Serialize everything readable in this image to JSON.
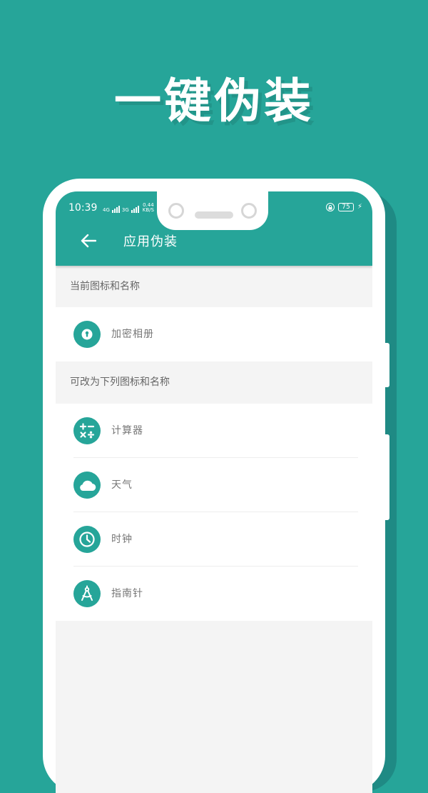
{
  "headline": "一键伪装",
  "status_bar": {
    "time": "10:39",
    "signal_1": "4G",
    "signal_2": "3G",
    "net_speed": "0.44",
    "net_unit": "KB/S",
    "battery": "75"
  },
  "app_bar": {
    "title": "应用伪装",
    "back_icon": "arrow-left-icon"
  },
  "current_section": {
    "header": "当前图标和名称",
    "item": {
      "label": "加密相册",
      "icon": "keyhole-icon"
    }
  },
  "options_section": {
    "header": "可改为下列图标和名称",
    "items": [
      {
        "label": "计算器",
        "icon": "calculator-icon"
      },
      {
        "label": "天气",
        "icon": "cloud-icon"
      },
      {
        "label": "时钟",
        "icon": "clock-icon"
      },
      {
        "label": "指南针",
        "icon": "compass-icon"
      }
    ]
  },
  "colors": {
    "brand": "#26a599",
    "background": "#f4f4f4",
    "text_secondary": "#777777"
  }
}
